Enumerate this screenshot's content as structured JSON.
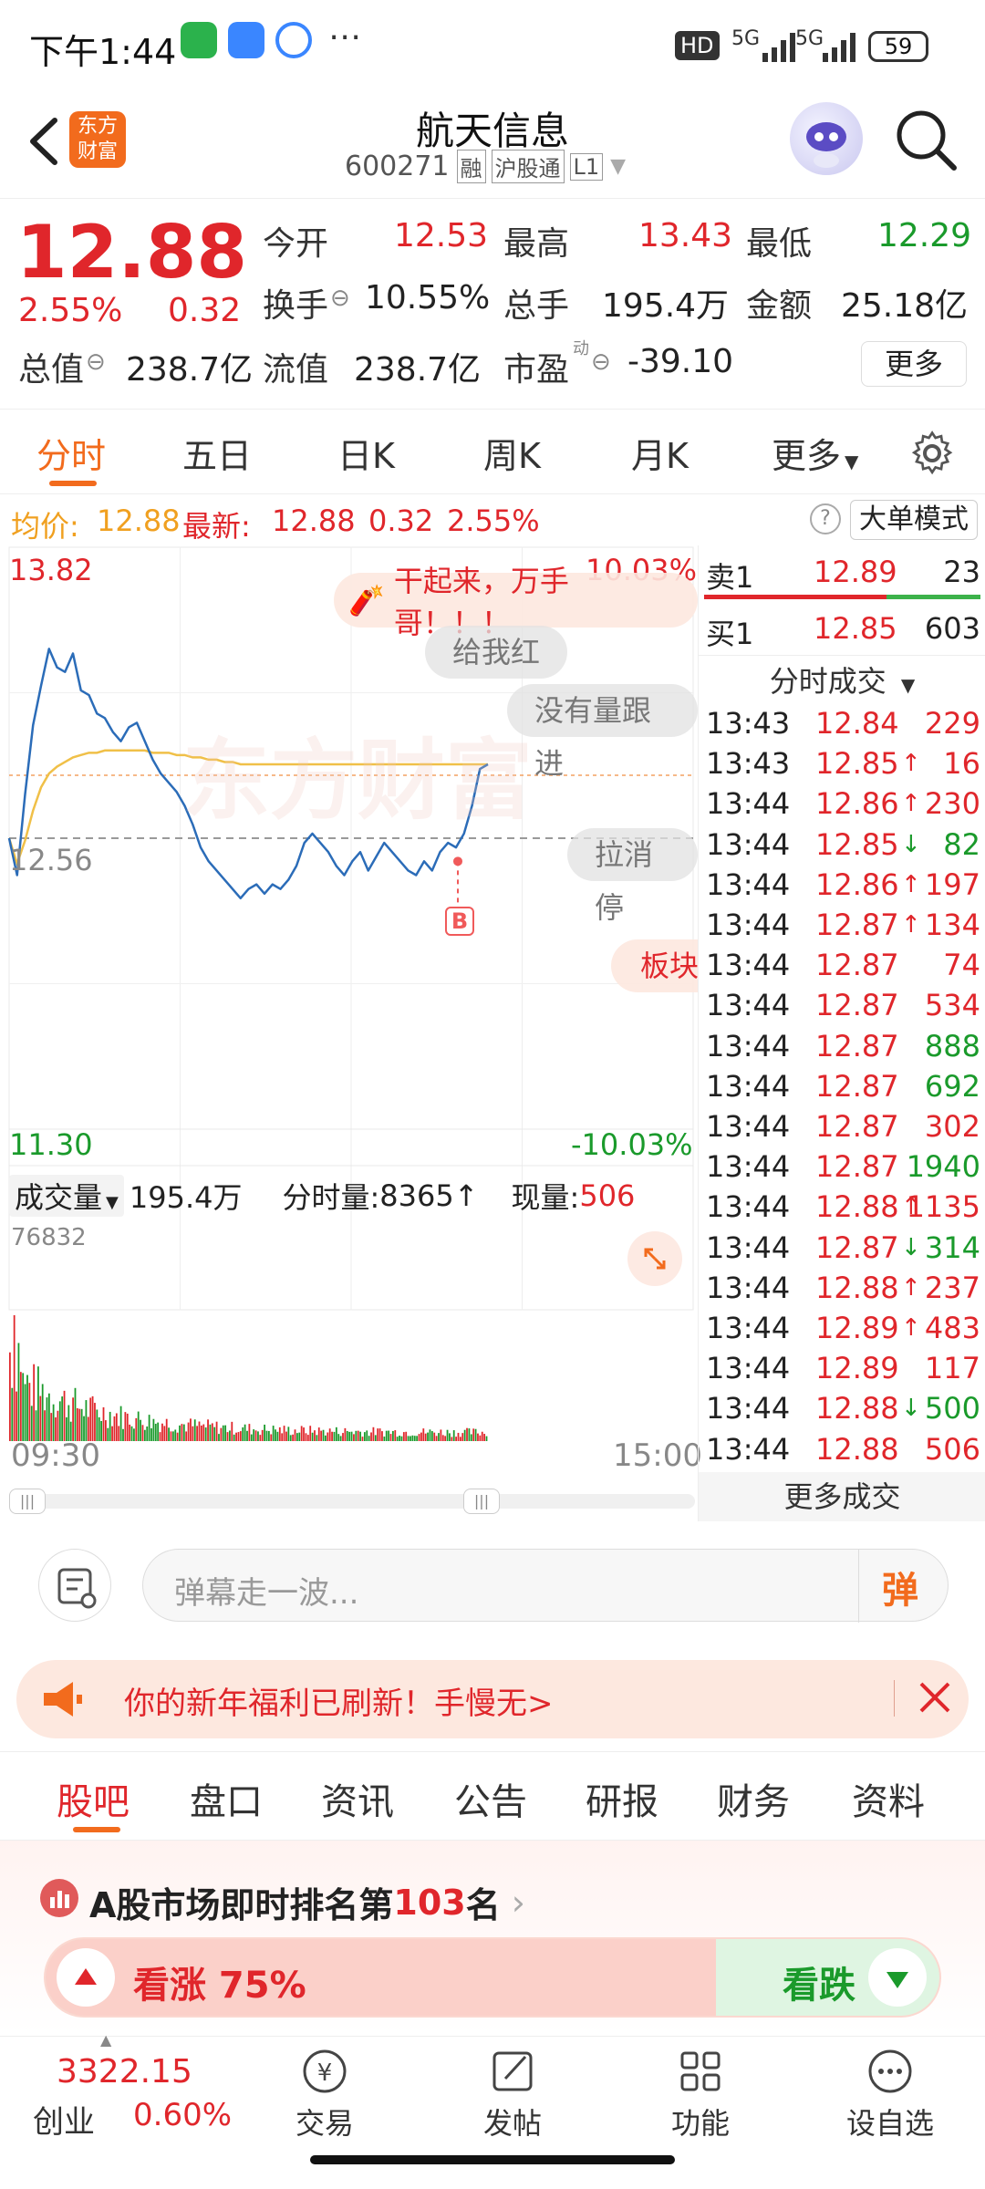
{
  "status_bar": {
    "time": "下午1:44",
    "hd": "HD",
    "net1": "5G",
    "net2": "5G",
    "battery": "59"
  },
  "nav": {
    "logo_line1": "东方",
    "logo_line2": "财富",
    "title": "航天信息",
    "code": "600271",
    "tag_rong": "融",
    "tag_hgt": "沪股通",
    "tag_l1": "L1"
  },
  "quote": {
    "price": "12.88",
    "change_pct": "2.55%",
    "change": "0.32",
    "open_label": "今开",
    "open": "12.53",
    "high_label": "最高",
    "high": "13.43",
    "low_label": "最低",
    "low": "12.29",
    "turnover_label": "换手",
    "turnover": "10.55%",
    "volume_label": "总手",
    "volume": "195.4万",
    "amount_label": "金额",
    "amount": "25.18亿",
    "mktcap_label": "总值",
    "mktcap": "238.7亿",
    "float_label": "流值",
    "float": "238.7亿",
    "pe_label": "市盈",
    "pe_sup": "动",
    "pe": "-39.10",
    "more_button": "更多"
  },
  "kline_tabs": {
    "items": [
      "分时",
      "五日",
      "日K",
      "周K",
      "月K",
      "更多"
    ],
    "active": "分时"
  },
  "info_line": {
    "avg_label": "均价:",
    "avg": "12.88",
    "latest_label": "最新:",
    "latest": "12.88",
    "chg": "0.32",
    "pct": "2.55%",
    "mode_button": "大单模式"
  },
  "chart": {
    "y_max": "13.82",
    "y_min": "11.30",
    "pct_max": "10.03%",
    "pct_min": "-10.03%",
    "prev_close": "12.56",
    "tip_main": "干起来，万手哥！！！",
    "tip_give": "给我红",
    "tip_novol": "没有量跟进",
    "tip_pull": "拉消停",
    "tip_sector": "板块",
    "marker": "B",
    "watermark": "东方财富",
    "vol_label": "成交量",
    "vol_total": "195.4万",
    "vol_min_label": "分时量:",
    "vol_min": "8365",
    "vol_now_label": "现量:",
    "vol_now": "506",
    "vol_max": "76832",
    "time_start": "09:30",
    "time_end": "15:00"
  },
  "chart_data": {
    "type": "line",
    "title": "",
    "xlabel": "",
    "ylabel": "",
    "ylim": [
      11.3,
      13.82
    ],
    "prev_close": 12.56,
    "x_range": [
      "09:30",
      "15:00"
    ],
    "series": [
      {
        "name": "price",
        "values": [
          12.56,
          12.4,
          12.75,
          13.05,
          13.22,
          13.38,
          13.3,
          13.28,
          13.36,
          13.2,
          13.18,
          13.1,
          13.08,
          13.02,
          12.98,
          13.04,
          13.06,
          12.98,
          12.9,
          12.84,
          12.8,
          12.76,
          12.7,
          12.62,
          12.52,
          12.46,
          12.42,
          12.38,
          12.34,
          12.3,
          12.34,
          12.36,
          12.32,
          12.36,
          12.34,
          12.38,
          12.44,
          12.54,
          12.58,
          12.54,
          12.5,
          12.44,
          12.4,
          12.46,
          12.5,
          12.42,
          12.48,
          12.54,
          12.5,
          12.46,
          12.42,
          12.4,
          12.46,
          12.42,
          12.5,
          12.54,
          12.52,
          12.58,
          12.7,
          12.86,
          12.88
        ]
      },
      {
        "name": "avg",
        "values": [
          12.56,
          12.45,
          12.55,
          12.68,
          12.78,
          12.84,
          12.87,
          12.89,
          12.91,
          12.92,
          12.93,
          12.93,
          12.94,
          12.94,
          12.94,
          12.94,
          12.94,
          12.94,
          12.93,
          12.93,
          12.93,
          12.92,
          12.92,
          12.91,
          12.91,
          12.9,
          12.9,
          12.89,
          12.89,
          12.88,
          12.88,
          12.88,
          12.88,
          12.88,
          12.88,
          12.88,
          12.88,
          12.88,
          12.88,
          12.88,
          12.88,
          12.88,
          12.88,
          12.88,
          12.88,
          12.88,
          12.88,
          12.88,
          12.88,
          12.88,
          12.88,
          12.88,
          12.88,
          12.88,
          12.88,
          12.88,
          12.88,
          12.88,
          12.88,
          12.88,
          12.88
        ]
      }
    ],
    "volume_max": 76832
  },
  "order_book": {
    "sell_label": "卖1",
    "sell_price": "12.89",
    "sell_vol": "23",
    "buy_label": "买1",
    "buy_price": "12.85",
    "buy_vol": "603",
    "ticks_header": "分时成交",
    "ticks": [
      {
        "time": "13:43",
        "price": "12.84",
        "arrow": "",
        "vol": "229",
        "pc": "red",
        "vc": "red"
      },
      {
        "time": "13:43",
        "price": "12.85",
        "arrow": "↑",
        "vol": "16",
        "pc": "red",
        "vc": "red"
      },
      {
        "time": "13:44",
        "price": "12.86",
        "arrow": "↑",
        "vol": "230",
        "pc": "red",
        "vc": "red"
      },
      {
        "time": "13:44",
        "price": "12.85",
        "arrow": "↓",
        "vol": "82",
        "pc": "red",
        "vc": "green"
      },
      {
        "time": "13:44",
        "price": "12.86",
        "arrow": "↑",
        "vol": "197",
        "pc": "red",
        "vc": "red"
      },
      {
        "time": "13:44",
        "price": "12.87",
        "arrow": "↑",
        "vol": "134",
        "pc": "red",
        "vc": "red"
      },
      {
        "time": "13:44",
        "price": "12.87",
        "arrow": "",
        "vol": "74",
        "pc": "red",
        "vc": "red"
      },
      {
        "time": "13:44",
        "price": "12.87",
        "arrow": "",
        "vol": "534",
        "pc": "red",
        "vc": "red"
      },
      {
        "time": "13:44",
        "price": "12.87",
        "arrow": "",
        "vol": "888",
        "pc": "red",
        "vc": "green"
      },
      {
        "time": "13:44",
        "price": "12.87",
        "arrow": "",
        "vol": "692",
        "pc": "red",
        "vc": "green"
      },
      {
        "time": "13:44",
        "price": "12.87",
        "arrow": "",
        "vol": "302",
        "pc": "red",
        "vc": "red"
      },
      {
        "time": "13:44",
        "price": "12.87",
        "arrow": "",
        "vol": "1940",
        "pc": "red",
        "vc": "green"
      },
      {
        "time": "13:44",
        "price": "12.88",
        "arrow": "↑",
        "vol": "1135",
        "pc": "red",
        "vc": "red"
      },
      {
        "time": "13:44",
        "price": "12.87",
        "arrow": "↓",
        "vol": "314",
        "pc": "red",
        "vc": "green"
      },
      {
        "time": "13:44",
        "price": "12.88",
        "arrow": "↑",
        "vol": "237",
        "pc": "red",
        "vc": "red"
      },
      {
        "time": "13:44",
        "price": "12.89",
        "arrow": "↑",
        "vol": "483",
        "pc": "red",
        "vc": "red"
      },
      {
        "time": "13:44",
        "price": "12.89",
        "arrow": "",
        "vol": "117",
        "pc": "red",
        "vc": "red"
      },
      {
        "time": "13:44",
        "price": "12.88",
        "arrow": "↓",
        "vol": "500",
        "pc": "red",
        "vc": "green"
      },
      {
        "time": "13:44",
        "price": "12.88",
        "arrow": "",
        "vol": "506",
        "pc": "red",
        "vc": "red"
      }
    ],
    "more_ticks": "更多成交"
  },
  "input_bar": {
    "placeholder": "弹幕走一波...",
    "danmu_button": "弹"
  },
  "banner": {
    "text": "你的新年福利已刷新！手慢无>"
  },
  "bottom_tabs": {
    "items": [
      "股吧",
      "盘口",
      "资讯",
      "公告",
      "研报",
      "财务",
      "资料"
    ],
    "active": "股吧"
  },
  "ranking": {
    "prefix": "A股市场即时排名第",
    "rank": "103",
    "suffix": "名",
    "up_label": "看涨 75%",
    "down_label": "看跌",
    "up_ratio": 0.75
  },
  "bottom_nav": {
    "index_value": "3322.15",
    "index_name": "创业",
    "index_pct": "0.60%",
    "trade": "交易",
    "post": "发帖",
    "func": "功能",
    "watch": "设自选"
  },
  "colors": {
    "up": "#e0262b",
    "down": "#1a9a2b",
    "accent": "#f26b1d",
    "price_line": "#2b6cb8",
    "avg_line": "#f0c048"
  }
}
